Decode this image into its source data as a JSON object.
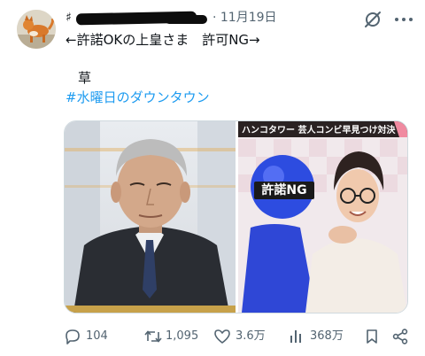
{
  "post": {
    "date": "· 11月19日",
    "name_lead": "♯",
    "line1": "←許諾OKの上皇さま　許可NG→",
    "line2": "草",
    "hashtag": "#水曜日のダウンタウン"
  },
  "media": {
    "banner": "ハンコタワー 芸人コンビ早見つけ対決",
    "ng_label": "許諾NG"
  },
  "actions": {
    "reply_count": "104",
    "retweet_count": "1,095",
    "like_count": "3.6万",
    "view_count": "368万"
  },
  "colors": {
    "text": "#0f1419",
    "muted": "#536471",
    "link": "#1d9bf0",
    "border": "#cfd9de"
  },
  "icons": {
    "grok": "grok-icon",
    "more": "more-icon",
    "reply": "reply-icon",
    "retweet": "retweet-icon",
    "like": "heart-icon",
    "views": "views-icon",
    "bookmark": "bookmark-icon",
    "share": "share-icon"
  }
}
